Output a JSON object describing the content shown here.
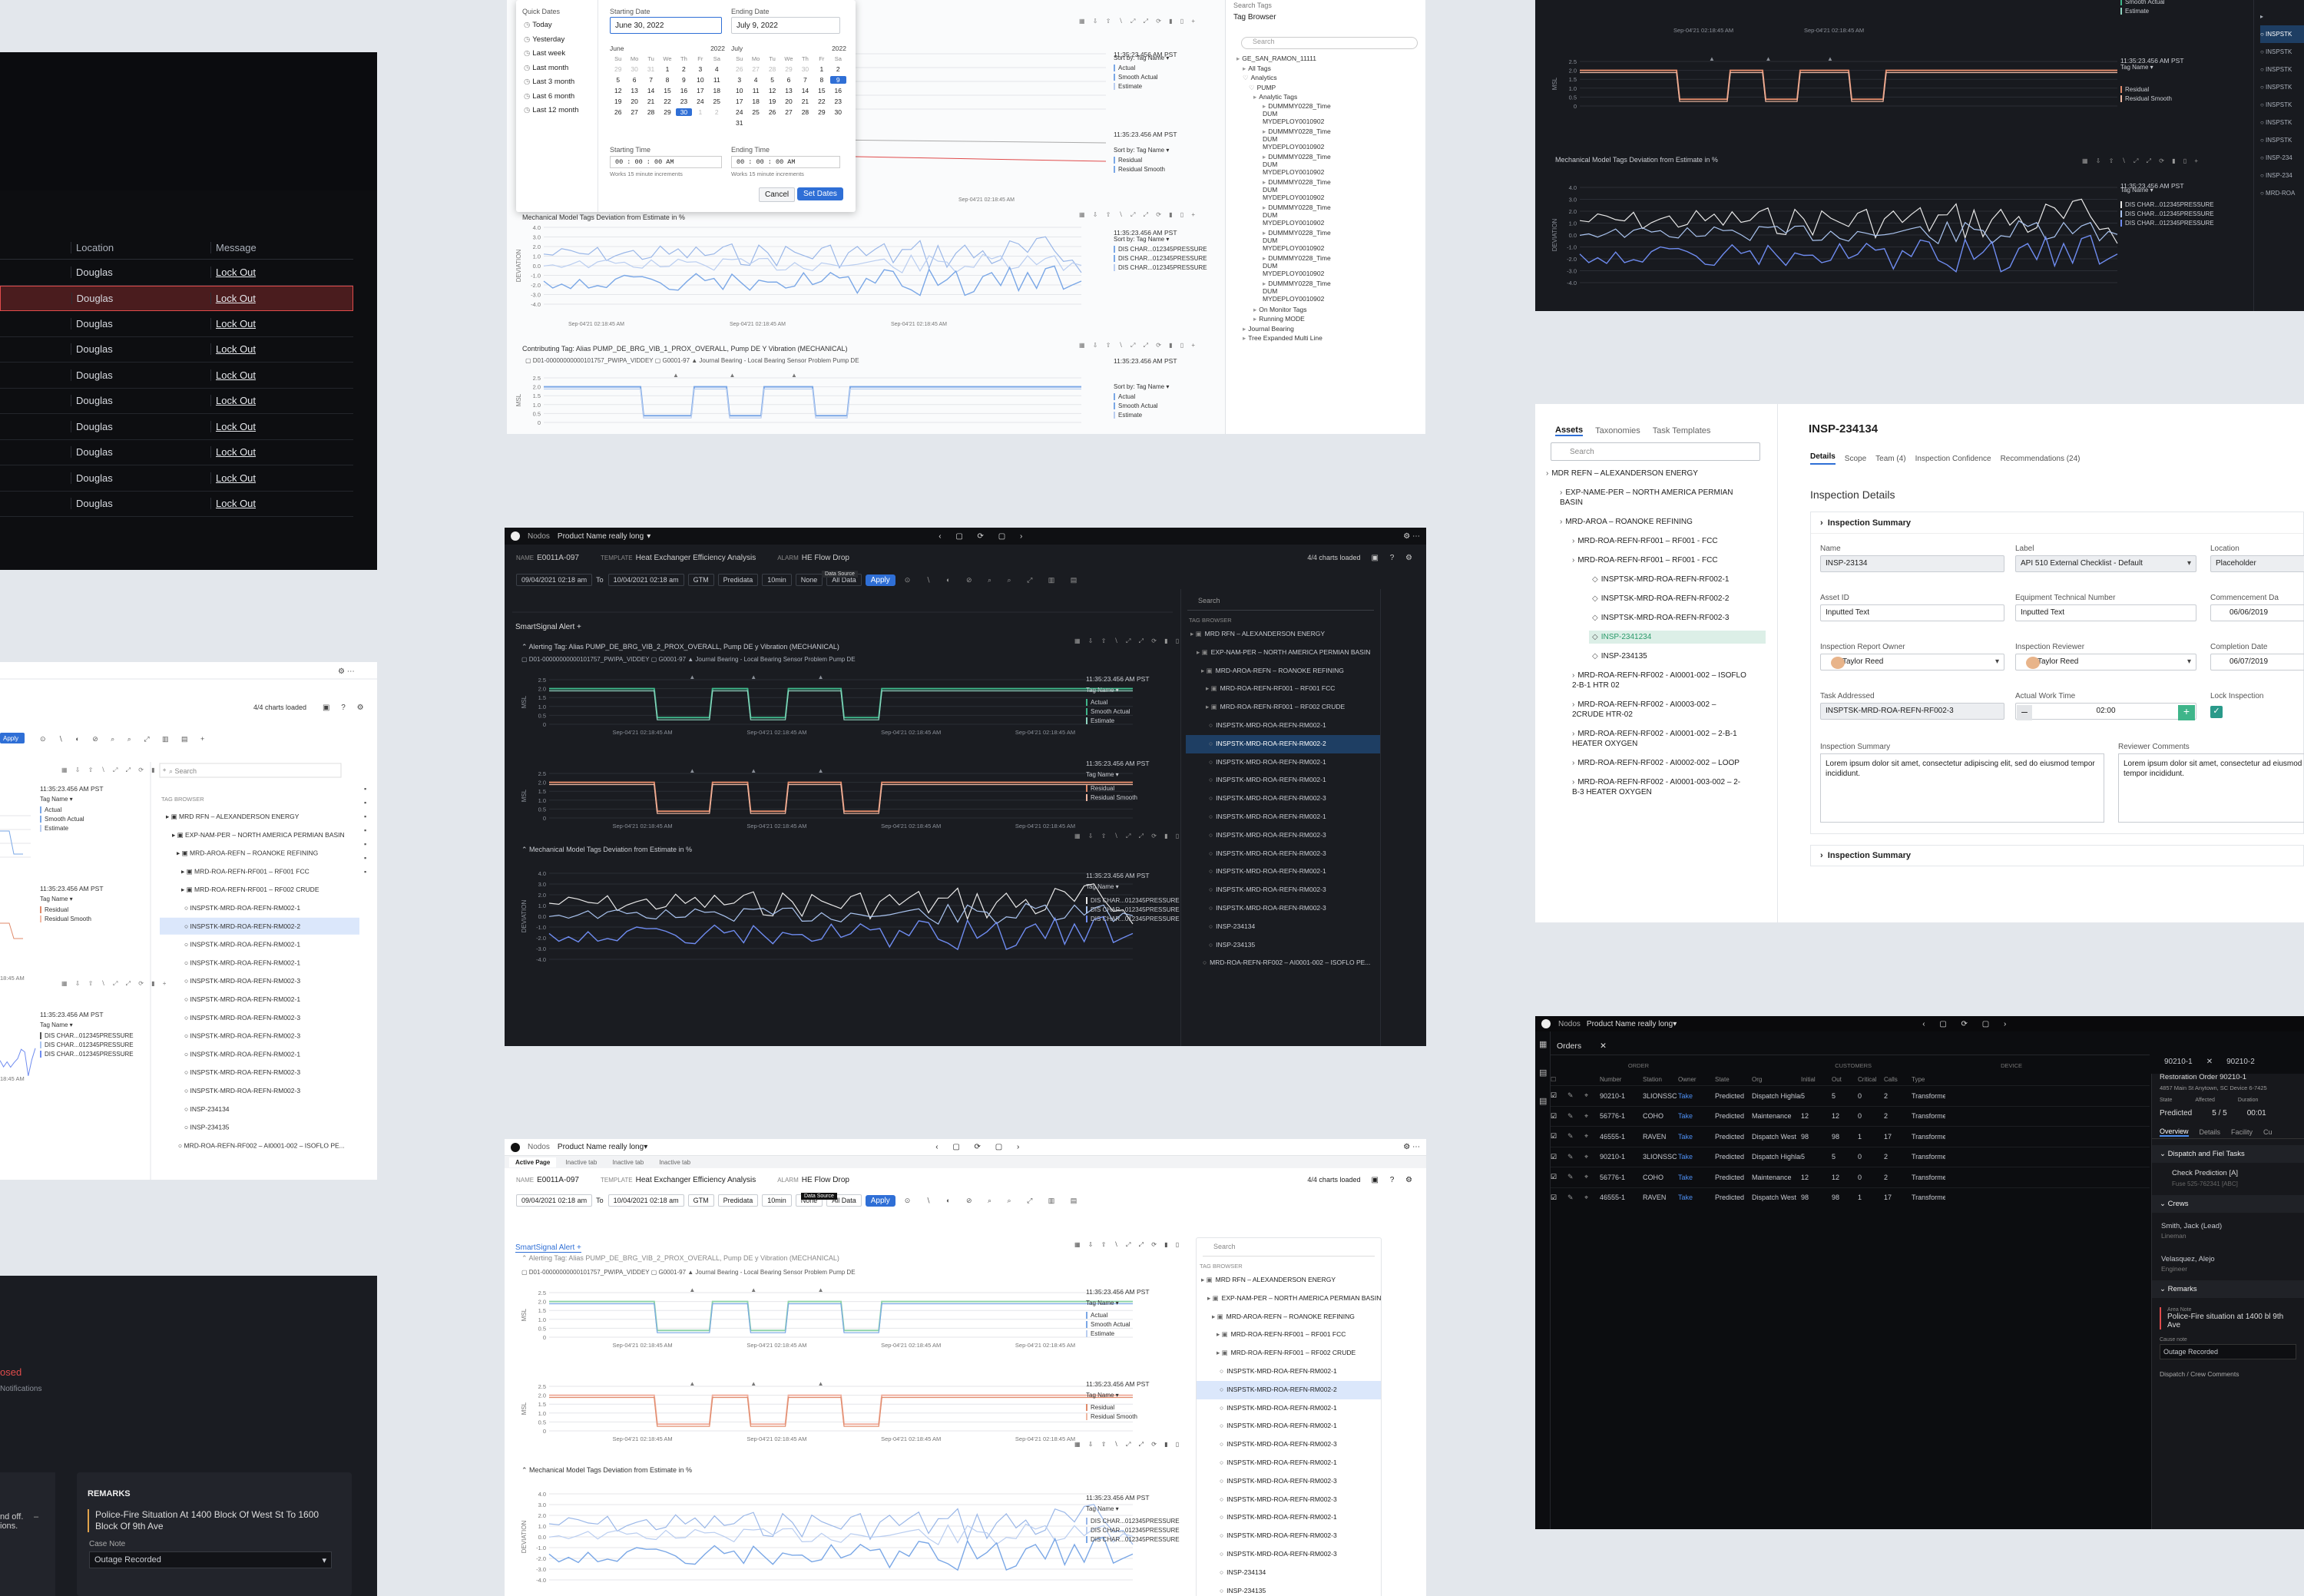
{
  "lockout": {
    "headers": [
      "Location",
      "Message"
    ],
    "rows": [
      {
        "location": "Douglas",
        "message": "Lock Out"
      },
      {
        "location": "Douglas",
        "message": "Lock Out"
      },
      {
        "location": "Douglas",
        "message": "Lock Out"
      },
      {
        "location": "Douglas",
        "message": "Lock Out"
      },
      {
        "location": "Douglas",
        "message": "Lock Out"
      },
      {
        "location": "Douglas",
        "message": "Lock Out"
      },
      {
        "location": "Douglas",
        "message": "Lock Out"
      },
      {
        "location": "Douglas",
        "message": "Lock Out"
      },
      {
        "location": "Douglas",
        "message": "Lock Out"
      },
      {
        "location": "Douglas",
        "message": "Lock Out"
      }
    ]
  },
  "datepicker": {
    "quick_title": "Quick Dates",
    "quick": [
      "Today",
      "Yesterday",
      "Last week",
      "Last month",
      "Last 3 month",
      "Last 6 month",
      "Last 12 month"
    ],
    "start_label": "Starting Date",
    "start_value": "June 30, 2022",
    "end_label": "Ending Date",
    "end_value": "July 9, 2022",
    "month1": "June",
    "year1": "2022",
    "month2": "July",
    "year2": "2022",
    "weekdays": [
      "Su",
      "Mo",
      "Tu",
      "We",
      "Th",
      "Fr",
      "Sa"
    ],
    "start_time_label": "Starting Time",
    "end_time_label": "Ending Time",
    "hint": "Works 15 minute increments",
    "cancel": "Cancel",
    "set": "Set Dates"
  },
  "topcenter": {
    "search": "Search Tags",
    "tag_browser": "Tag Browser",
    "tree": [
      "GE_SAN_RAMON_11111",
      "All Tags",
      "Analytics",
      "PUMP",
      "Analytic Tags",
      "DUMMMY0228_Time DUM MYDEPLOY0010902",
      "DUMMMY0228_Time DUM MYDEPLOY0010902",
      "DUMMMY0228_Time DUM MYDEPLOY0010902",
      "DUMMMY0228_Time DUM MYDEPLOY0010902",
      "DUMMMY0228_Time DUM MYDEPLOY0010902",
      "DUMMMY0228_Time DUM MYDEPLOY0010902",
      "DUMMMY0228_Time DUM MYDEPLOY0010902",
      "DUMMMY0228_Time DUM MYDEPLOY0010902",
      "On Monitor Tags",
      "Running MODE",
      "Journal Bearing",
      "Tree Expanded Multi Line"
    ],
    "deviation_title": "Mechanical Model Tags Deviation from Estimate in %",
    "contrib_title": "Contributing Tag: Alias PUMP_DE_BRG_VIB_1_PROX_OVERALL, Pump DE Y Vibration (MECHANICAL)",
    "timestamp": "11:35:23.456 AM PST",
    "sensor": "Journal Bearing - Local Bearing Sensor Problem Pump DE"
  },
  "smartsignal": {
    "brand": "Nodos",
    "product": "Product Name really long",
    "name_label": "NAME",
    "name": "E0011A-097",
    "template_label": "TEMPLATE",
    "template": "Heat Exchanger Efficiency Analysis",
    "alarm_label": "ALARM",
    "alarm": "HE Flow Drop",
    "tooltip": "Data Source",
    "charts_loaded": "4/4 charts loaded",
    "date_from": "09/04/2021 02:18 am",
    "to": "To",
    "date_to": "10/04/2021 02:18 am",
    "tz": "GTM",
    "predidata": "Predidata",
    "interval": "10min",
    "none": "None",
    "alldata": "All Data",
    "apply": "Apply",
    "alert_tab": "SmartSignal Alert",
    "alerting": "Alerting Tag: Alias PUMP_DE_BRG_VIB_2_PROX_OVERALL, Pump DE y Vibration (MECHANICAL)",
    "d01": "D01-00000000000101757_PWIPA_VIDDEY",
    "g0001": "G0001-97",
    "sensor": "Journal Bearing - Local Bearing Sensor Problem Pump DE",
    "timestamp": "11:35:23.456 AM PST",
    "xticks": [
      "Sep-04'21 02:18:45 AM",
      "Sep-04'21 02:18:45 AM",
      "Sep-04'21 02:18:45 AM",
      "Sep-04'21 02:18:45 AM"
    ],
    "legend1": [
      "Actual",
      "Smooth Actual",
      "Estimate"
    ],
    "legend2": [
      "Residual",
      "Residual Smooth"
    ],
    "legend3": [
      "DIS CHAR...012345PRESSURE",
      "DIS CHAR...012345PRESSURE",
      "DIS CHAR...012345PRESSURE"
    ],
    "sort": "Tag Name",
    "dev_title": "Mechanical Model Tags Deviation from Estimate in %",
    "ylabels": [
      "MSL",
      "MSL",
      "DEVIATION"
    ],
    "search": "Search",
    "tag_browser": "TAG BROWSER",
    "tree": [
      "MRD RFN – ALEXANDERSON ENERGY",
      "EXP-NAM-PER – NORTH AMERICA PERMIAN BASIN",
      "MRD-AROA-REFN – ROANOKE REFINING",
      "MRD-ROA-REFN-RF001 – RF001 FCC",
      "MRD-ROA-REFN-RF001 – RF002 CRUDE",
      "INSPSTK-MRD-ROA-REFN-RM002-1",
      "INSPSTK-MRD-ROA-REFN-RM002-2",
      "INSPSTK-MRD-ROA-REFN-RM002-1",
      "INSPSTK-MRD-ROA-REFN-RM002-1",
      "INSPSTK-MRD-ROA-REFN-RM002-3",
      "INSPSTK-MRD-ROA-REFN-RM002-1",
      "INSPSTK-MRD-ROA-REFN-RM002-3",
      "INSPSTK-MRD-ROA-REFN-RM002-3",
      "INSPSTK-MRD-ROA-REFN-RM002-1",
      "INSPSTK-MRD-ROA-REFN-RM002-3",
      "INSPSTK-MRD-ROA-REFN-RM002-3",
      "INSP-234134",
      "INSP-234135",
      "MRD-ROA-REFN-RF002 – AI0001-002 – ISOFLO PE..."
    ],
    "tabs": [
      "Active Page",
      "Inactive tab",
      "Inactive tab",
      "Inactive tab"
    ]
  },
  "inspection": {
    "tabs": [
      "Assets",
      "Taxonomies",
      "Task Templates"
    ],
    "search": "Search",
    "tree": [
      "MDR REFN – ALEXANDERSON ENERGY",
      "EXP-NAME-PER – NORTH AMERICA PERMIAN BASIN",
      "MRD-AROA – ROANOKE REFINING",
      "MRD-ROA-REFN-RF001 – RF001 - FCC",
      "MRD-ROA-REFN-RF001 – RF001 - FCC",
      "INSPTSK-MRD-ROA-REFN-RF002-1",
      "INSPTSK-MRD-ROA-REFN-RF002-2",
      "INSPTSK-MRD-ROA-REFN-RF002-3",
      "INSP-2341234",
      "INSP-234135",
      "MRD-ROA-REFN-RF002 - AI0001-002 – ISOFLO 2-B-1 HTR 02",
      "MRD-ROA-REFN-RF002 - AI0003-002 – 2CRUDE HTR-02",
      "MRD-ROA-REFN-RF002 - AI0001-002 – 2-B-1 HEATER OXYGEN",
      "MRD-ROA-REFN-RF002 - AI0002-002 – LOOP",
      "MRD-ROA-REFN-RF002 - AI0001-003-002 – 2-B-3 HEATER OXYGEN"
    ],
    "title": "INSP-234134",
    "dtabs": [
      "Details",
      "Scope",
      "Team (4)",
      "Inspection Confidence",
      "Recommendations (24)"
    ],
    "section": "Inspection Details",
    "summary": "Inspection Summary",
    "name_label": "Name",
    "name": "INSP-23134",
    "label_label": "Label",
    "label": "API 510 External Checklist - Default",
    "location_label": "Location",
    "location": "Placeholder",
    "asset_label": "Asset ID",
    "asset": "Inputted Text",
    "etn_label": "Equipment Technical Number",
    "etn": "Inputted Text",
    "commence_label": "Commencement Da",
    "commence": "06/06/2019",
    "owner_label": "Inspection Report Owner",
    "owner": "Taylor Reed",
    "reviewer_label": "Inspection Reviewer",
    "reviewer": "Taylor Reed",
    "completion_label": "Completion Date",
    "completion": "06/07/2019",
    "task_label": "Task Addressed",
    "task": "INSPTSK-MRD-ROA-REFN-RF002-3",
    "work_label": "Actual Work Time",
    "work": "02:00",
    "lock_label": "Lock Inspection",
    "sum_label": "Inspection Summary",
    "sum_text": "Lorem ipsum dolor sit amet, consectetur adipiscing elit, sed do eiusmod tempor incididunt.",
    "rev_label": "Reviewer Comments",
    "rev_text": "Lorem ipsum dolor sit amet, consectetur ad eiusmod tempor incididunt."
  },
  "orders": {
    "brand": "Nodos",
    "product": "Product Name really long",
    "tab": "Orders",
    "groups": [
      "ORDER",
      "CUSTOMERS",
      "DEVICE"
    ],
    "headers": [
      "Number",
      "Station",
      "Owner",
      "State",
      "Org",
      "Initial",
      "Out",
      "Critical",
      "Calls",
      "Type"
    ],
    "rows": [
      [
        "90210-1",
        "3LIONSSC",
        "Take",
        "Predicted",
        "Dispatch Highlands",
        "5",
        "5",
        "0",
        "2",
        "Transformer"
      ],
      [
        "56776-1",
        "COHO",
        "Take",
        "Predicted",
        "Maintenance",
        "12",
        "12",
        "0",
        "2",
        "Transformer"
      ],
      [
        "46555-1",
        "RAVEN",
        "Take",
        "Predicted",
        "Dispatch West",
        "98",
        "98",
        "1",
        "17",
        "Transformer"
      ],
      [
        "90210-1",
        "3LIONSSC",
        "Take",
        "Predicted",
        "Dispatch Highlands",
        "5",
        "5",
        "0",
        "2",
        "Transformer"
      ],
      [
        "56776-1",
        "COHO",
        "Take",
        "Predicted",
        "Maintenance",
        "12",
        "12",
        "0",
        "2",
        "Transformer"
      ],
      [
        "46555-1",
        "RAVEN",
        "Take",
        "Predicted",
        "Dispatch West",
        "98",
        "98",
        "1",
        "17",
        "Transformer"
      ]
    ],
    "detail_tab1": "90210-1",
    "detail_tab2": "90210-2",
    "restoration": "Restoration Order 90210-1",
    "address": "4857 Main St Anytown, SC",
    "device": "Device 6-7425",
    "state_label": "State",
    "state": "Predicted",
    "affected_label": "Affected",
    "affected": "5 / 5",
    "duration_label": "Duration",
    "duration": "00:01",
    "dtabs": [
      "Overview",
      "Details",
      "Facility",
      "Cu"
    ],
    "dispatch": "Dispatch and Fiel Tasks",
    "check": "Check Prediction [A]",
    "fuse": "Fuse 525-762341 [ABC]",
    "crews": "Crews",
    "crew1": "Smith, Jack (Lead)",
    "crew1r": "Lineman",
    "crew2": "Velasquez, Alejo",
    "crew2r": "Engineer",
    "remarks": "Remarks",
    "area_note": "Area Note",
    "remark": "Police-Fire situation at 1400 bl 9th Ave",
    "cause_note": "Cause note",
    "cause": "Outage Recorded",
    "crew_comments": "Dispatch / Crew Comments"
  },
  "bottomleft": {
    "closed": "osed",
    "notif": "Notifications",
    "offtext": "nd off.\nions.",
    "remarks": "REMARKS",
    "remark_text": "Police-Fire Situation At 1400 Block Of West St To 1600 Block Of 9th Ave",
    "case_label": "Case Note",
    "case_value": "Outage Recorded"
  },
  "chart_data": [
    {
      "type": "line",
      "title": "",
      "series": [
        {
          "name": "Actual",
          "values": [
            2,
            2,
            2,
            2,
            0.3,
            0.3,
            2,
            2,
            2,
            0.3,
            2,
            2,
            2,
            2,
            2,
            2
          ]
        },
        {
          "name": "Smooth Actual",
          "values": [
            1.9,
            1.9,
            1.9,
            1.9,
            0.4,
            0.4,
            1.9,
            1.9,
            1.9,
            0.4,
            1.9,
            1.9,
            1.9,
            1.9,
            1.9,
            1.9
          ]
        }
      ],
      "ylim": [
        0,
        3
      ]
    },
    {
      "type": "line",
      "title": "",
      "series": [
        {
          "name": "Residual",
          "values": [
            2,
            2,
            2,
            2,
            0.3,
            0.3,
            2,
            2,
            2,
            0.3,
            2,
            2,
            2,
            2,
            2,
            2
          ]
        },
        {
          "name": "Residual Smooth",
          "values": [
            1.9,
            1.9,
            1.9,
            1.9,
            0.4,
            0.4,
            1.9,
            1.9,
            1.9,
            0.4,
            1.9,
            1.9,
            1.9,
            1.9,
            1.9,
            1.9
          ]
        }
      ],
      "ylim": [
        0,
        3
      ]
    },
    {
      "type": "line",
      "title": "Mechanical Model Tags Deviation from Estimate in %",
      "ylabel": "DEVIATION",
      "ylim": [
        -4,
        4
      ]
    }
  ],
  "colors": {
    "accent": "#2f6fd6",
    "red": "#e04b4b",
    "green": "#3fb58a",
    "orange": "#e08a5a",
    "lightblue": "#7aa7e6",
    "bg": "#e3e7ec"
  }
}
